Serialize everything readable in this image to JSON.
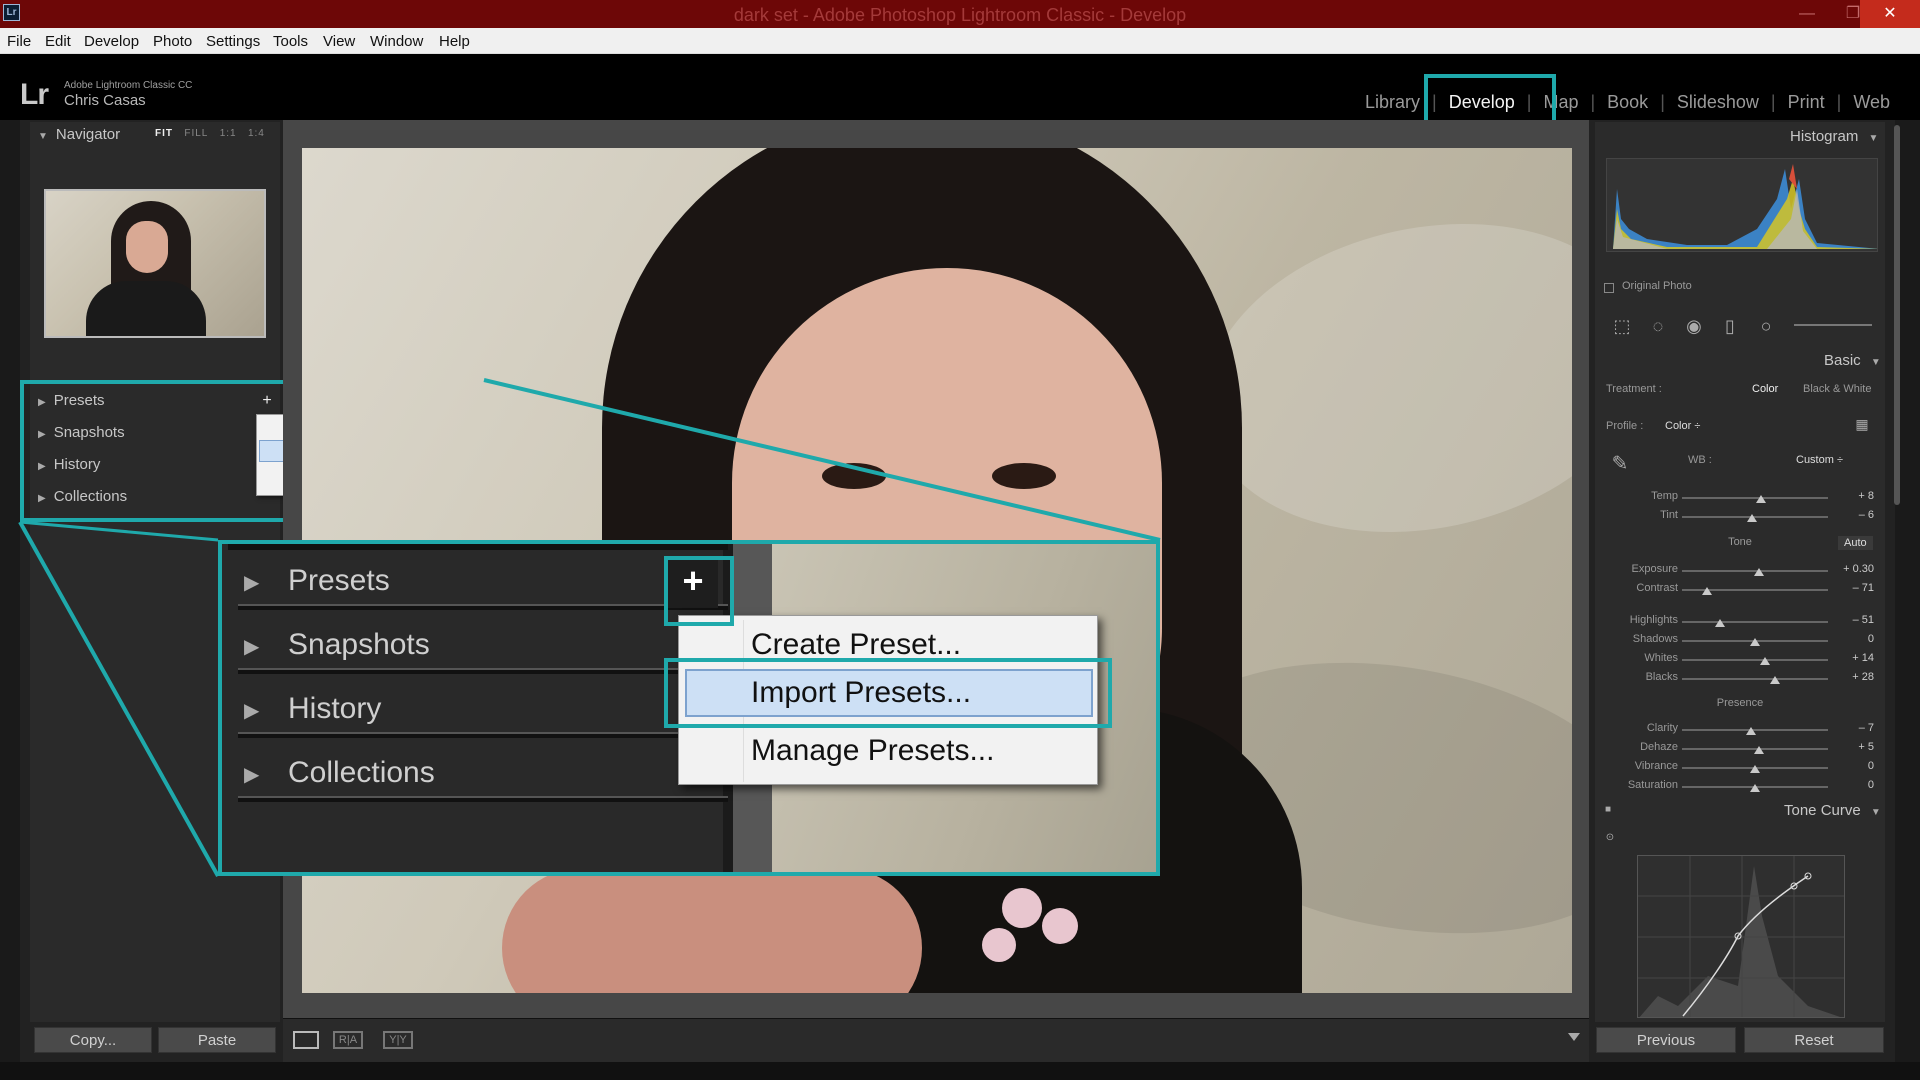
{
  "window": {
    "app_icon": "Lr",
    "title": "dark set - Adobe Photoshop Lightroom Classic - Develop",
    "minimize": "—",
    "maximize": "❐",
    "close": "✕"
  },
  "menu": [
    "File",
    "Edit",
    "Develop",
    "Photo",
    "Settings",
    "Tools",
    "View",
    "Window",
    "Help"
  ],
  "identity": {
    "logo": "Lr",
    "product": "Adobe Lightroom Classic CC",
    "user": "Chris Casas"
  },
  "modules": {
    "library": "Library",
    "develop": "Develop",
    "map": "Map",
    "book": "Book",
    "slideshow": "Slideshow",
    "print": "Print",
    "web": "Web",
    "active": "Develop"
  },
  "left": {
    "navigator": "Navigator",
    "nav_options": {
      "fit": "FIT",
      "fill": "FILL",
      "one": "1:1",
      "four": "1:4"
    },
    "panels": [
      "Presets",
      "Snapshots",
      "History",
      "Collections"
    ],
    "copy_button": "Copy...",
    "paste_button": "Paste"
  },
  "preset_menu": {
    "items": [
      "Create Preset...",
      "Import Presets...",
      "Manage Presets..."
    ],
    "highlighted": "Import Presets..."
  },
  "right": {
    "histogram": "Histogram",
    "original_photo": "Original Photo",
    "basic": "Basic",
    "treatment_label": "Treatment :",
    "treatment_color": "Color",
    "treatment_bw": "Black & White",
    "profile_label": "Profile :",
    "profile_value": "Color ÷",
    "wb_label": "WB :",
    "wb_value": "Custom ÷",
    "tone_label": "Tone",
    "auto_label": "Auto",
    "presence_label": "Presence",
    "tone_curve": "Tone Curve",
    "previous_button": "Previous",
    "reset_button": "Reset",
    "sliders": [
      {
        "label": "Temp",
        "value": "+ 8",
        "pos": 0.54
      },
      {
        "label": "Tint",
        "value": "– 6",
        "pos": 0.48
      },
      {
        "label": "Exposure",
        "value": "+ 0.30",
        "pos": 0.53
      },
      {
        "label": "Contrast",
        "value": "– 71",
        "pos": 0.17
      },
      {
        "label": "Highlights",
        "value": "– 51",
        "pos": 0.26
      },
      {
        "label": "Shadows",
        "value": "0",
        "pos": 0.5
      },
      {
        "label": "Whites",
        "value": "+ 14",
        "pos": 0.57
      },
      {
        "label": "Blacks",
        "value": "+ 28",
        "pos": 0.64
      },
      {
        "label": "Clarity",
        "value": "– 7",
        "pos": 0.47
      },
      {
        "label": "Dehaze",
        "value": "+ 5",
        "pos": 0.53
      },
      {
        "label": "Vibrance",
        "value": "0",
        "pos": 0.5
      },
      {
        "label": "Saturation",
        "value": "0",
        "pos": 0.5
      }
    ]
  },
  "colors": {
    "highlight_teal": "#1fa9ab",
    "titlebar": "#6d0707",
    "menu_highlight": "#cde0f5"
  }
}
